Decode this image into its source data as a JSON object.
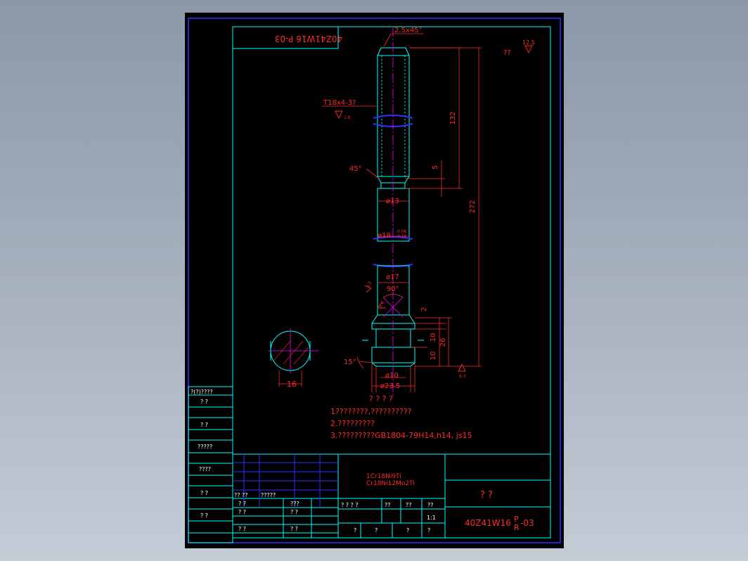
{
  "drawing_code_mirrored": "40Z41W16 P-03",
  "chamfer_top": "2.5x45°",
  "roughness_main": "12.5",
  "roughness_main_note": "??",
  "thread_spec": "T18x4-3?",
  "roughness_thread": "1.6",
  "dim_132": "132",
  "dim_272": "272",
  "dim_5": "5",
  "angle_45": "45°",
  "dia_13": "ø13",
  "dia_18": "ø18",
  "tol_18_upper": "-0.06",
  "tol_18_lower": "-0.16",
  "dia_17": "ø17",
  "angle_90": "90°",
  "roughness_side": "3.2",
  "roughness_cone": "1.6",
  "dim_2": "2",
  "dim_10a": "10",
  "dim_26": "26",
  "dim_10b": "10",
  "angle_15": "15°",
  "dia_10": "ø10",
  "dia_23_5": "ø23.5",
  "roughness_bottom": "6.3",
  "section_width": "16",
  "tech_req_title": "? ? ? ?",
  "note_1": "1????????,??????????",
  "note_2": "2.?????????",
  "note_3": "3.?????????GB1804-79H14,h14, js15",
  "left_strip": [
    "?(?)????",
    "?  ?",
    "?  ?",
    "?????",
    "????",
    "?  ?",
    "?  ?"
  ],
  "title_block": {
    "row_labels": [
      "?? ??",
      "?????",
      "? ?",
      "? ?",
      "? ?"
    ],
    "col_labels": [
      "???",
      "? ?",
      "? ?"
    ],
    "material_1": "1Cr18Ni9Ti",
    "material_2": "Cr18Ni12Mo2Ti",
    "stage_labels": [
      "? ? ? ?",
      "??",
      "??",
      "??"
    ],
    "scale": "1:1",
    "sheet_labels": [
      "?",
      "?",
      "?",
      "?"
    ],
    "part_name": "?   ?",
    "drawing_code": "40Z41W16",
    "code_sup": "P",
    "code_sub": "R",
    "code_suffix": "-03"
  },
  "colors": {
    "border_blue": "#3030ff",
    "frame_cyan": "#00ffff",
    "dim_red": "#ff2a2a",
    "center_magenta": "#ff00ff",
    "text_white": "#ffffff"
  }
}
